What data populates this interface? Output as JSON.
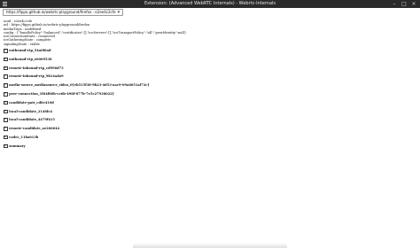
{
  "window": {
    "title": "Extension: (Advanced WebRTC Internals) - Webrtc-Internals"
  },
  "toolbar": {
    "url": "https://fippo.github.io/webrtc-playground/firefox - e2ee4c2cfe"
  },
  "info_lines": [
    "uuid : e2ee4c2cfe",
    "url : https://fippo.github.io/webrtc-playground/firefox",
    "mediaTrips : undefined",
    "config : {\"bundlePolicy\":\"balanced\",\"certificates\":[],\"iceServers\":[],\"iceTransportPolicy\":\"all\",\"peerIdentity\":null}",
    "iceConnectionState : connected",
    "iceGatheringState : complete",
    "signalingState : stable"
  ],
  "sections": [
    "outbound-rtp_54a0f6ad",
    "outbound-rtp_e0009538",
    "remote-inbound-rtp_cd996d73",
    "remote-inbound-rtp_9b14ada9",
    "media-source_mediasource_video_0{eb515f38-9b23-4d53-aac9-09a8051af72c}",
    "peer-connection_1f64f80b-ce6b-498f-877b-7e5c27938022}",
    "candidate-pair_cd6e410d",
    "local-candidate_2148fc4",
    "local-candidate_4479f415",
    "remote-candidate_ae266644",
    "codec_11ba013b",
    "summary"
  ],
  "icons": {
    "menu": "hamburger-menu-icon",
    "disclosure": "disclosure-triangle-icon"
  }
}
